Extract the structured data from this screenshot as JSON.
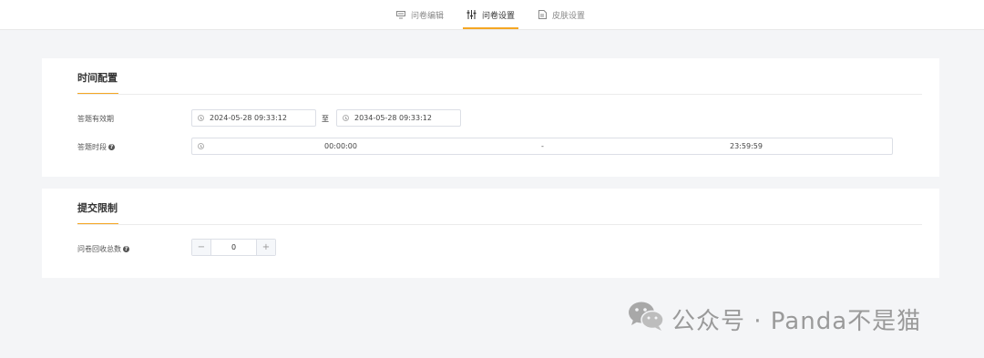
{
  "topnav": {
    "tabs": [
      {
        "label": "问卷编辑",
        "icon": "edit-form-icon",
        "active": false
      },
      {
        "label": "问卷设置",
        "icon": "sliders-icon",
        "active": true
      },
      {
        "label": "皮肤设置",
        "icon": "skin-icon",
        "active": false
      }
    ]
  },
  "time_config": {
    "title": "时间配置",
    "validity": {
      "label": "答题有效期",
      "start": "2024-05-28 09:33:12",
      "separator": "至",
      "end": "2034-05-28 09:33:12"
    },
    "period": {
      "label": "答题时段",
      "start": "00:00:00",
      "separator": "-",
      "end": "23:59:59"
    }
  },
  "submit_limit": {
    "title": "提交限制",
    "total": {
      "label": "问卷回收总数",
      "value": "0",
      "minus": "−",
      "plus": "+"
    }
  },
  "watermark": {
    "text": "公众号 · Panda不是猫"
  },
  "colors": {
    "accent": "#f5a623",
    "background": "#f4f5f7"
  }
}
